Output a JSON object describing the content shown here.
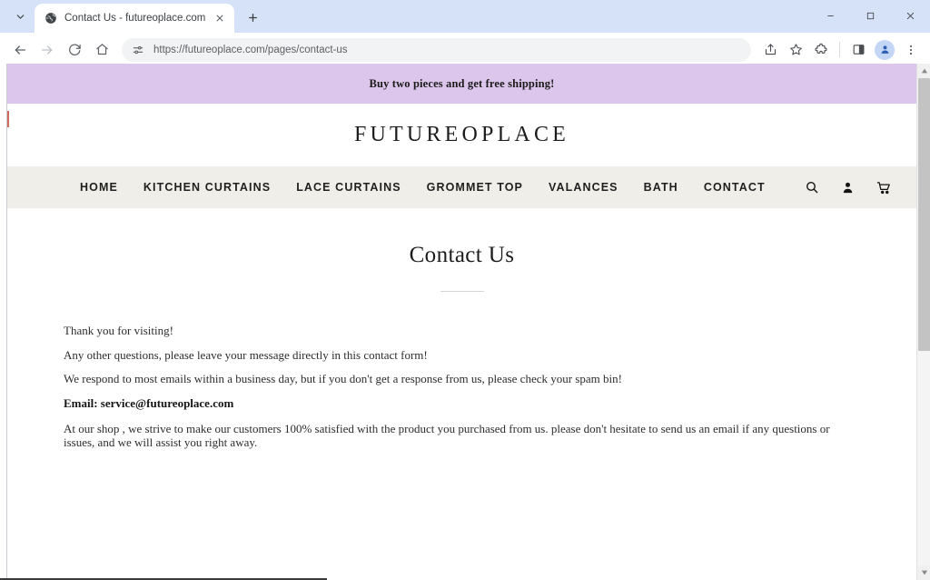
{
  "browser": {
    "tab": {
      "title": "Contact Us - futureoplace.com",
      "favicon_icon": "globe-icon",
      "close_icon": "close-icon"
    },
    "tab_search_icon": "chevron-down-icon",
    "new_tab_icon": "plus-icon",
    "window_controls": [
      {
        "name": "minimize",
        "icon": "minimize-icon"
      },
      {
        "name": "maximize",
        "icon": "maximize-icon"
      },
      {
        "name": "close",
        "icon": "close-icon"
      }
    ],
    "toolbar": {
      "back_icon": "arrow-left-icon",
      "forward_icon": "arrow-right-icon",
      "reload_icon": "reload-icon",
      "home_icon": "home-icon",
      "site_settings_icon": "tune-icon",
      "url": "https://futureoplace.com/pages/contact-us",
      "share_icon": "share-icon",
      "bookmark_icon": "star-icon",
      "extensions_icon": "puzzle-icon",
      "side_panel_icon": "side-panel-icon",
      "profile_icon": "person-icon",
      "menu_icon": "more-vertical-icon"
    }
  },
  "site": {
    "announcement": "Buy two pieces and get free shipping!",
    "logo": "FUTUREOPLACE",
    "nav": {
      "links": [
        "HOME",
        "KITCHEN CURTAINS",
        "LACE CURTAINS",
        "GROMMET TOP",
        "VALANCES",
        "BATH",
        "CONTACT"
      ],
      "icons": [
        {
          "name": "search-icon",
          "label": "Search"
        },
        {
          "name": "account-icon",
          "label": "Account"
        },
        {
          "name": "cart-icon",
          "label": "Cart"
        }
      ]
    },
    "page": {
      "title": "Contact Us",
      "paragraphs": [
        {
          "text": "Thank you for visiting!",
          "bold": false
        },
        {
          "text": "Any other questions, please leave your message directly in this contact form!",
          "bold": false
        },
        {
          "text": "We respond to most emails within a business day, but if you don't get a response from us, please check your spam bin!",
          "bold": false
        },
        {
          "text": "Email: service@futureoplace.com",
          "bold": true
        },
        {
          "text": "At our shop , we strive to make our customers 100% satisfied with the product you purchased from us. please don't hesitate to send us an email if any questions or issues, and we will assist you right away.",
          "bold": false
        }
      ]
    }
  },
  "colors": {
    "announcement_bg": "#dcc6eb",
    "nav_bg": "#efeee8",
    "tabstrip_bg": "#d6e2f7",
    "text": "#1c1c1c"
  },
  "scrollbar": {
    "up_arrow_icon": "caret-up-icon",
    "down_arrow_icon": "caret-down-icon"
  }
}
